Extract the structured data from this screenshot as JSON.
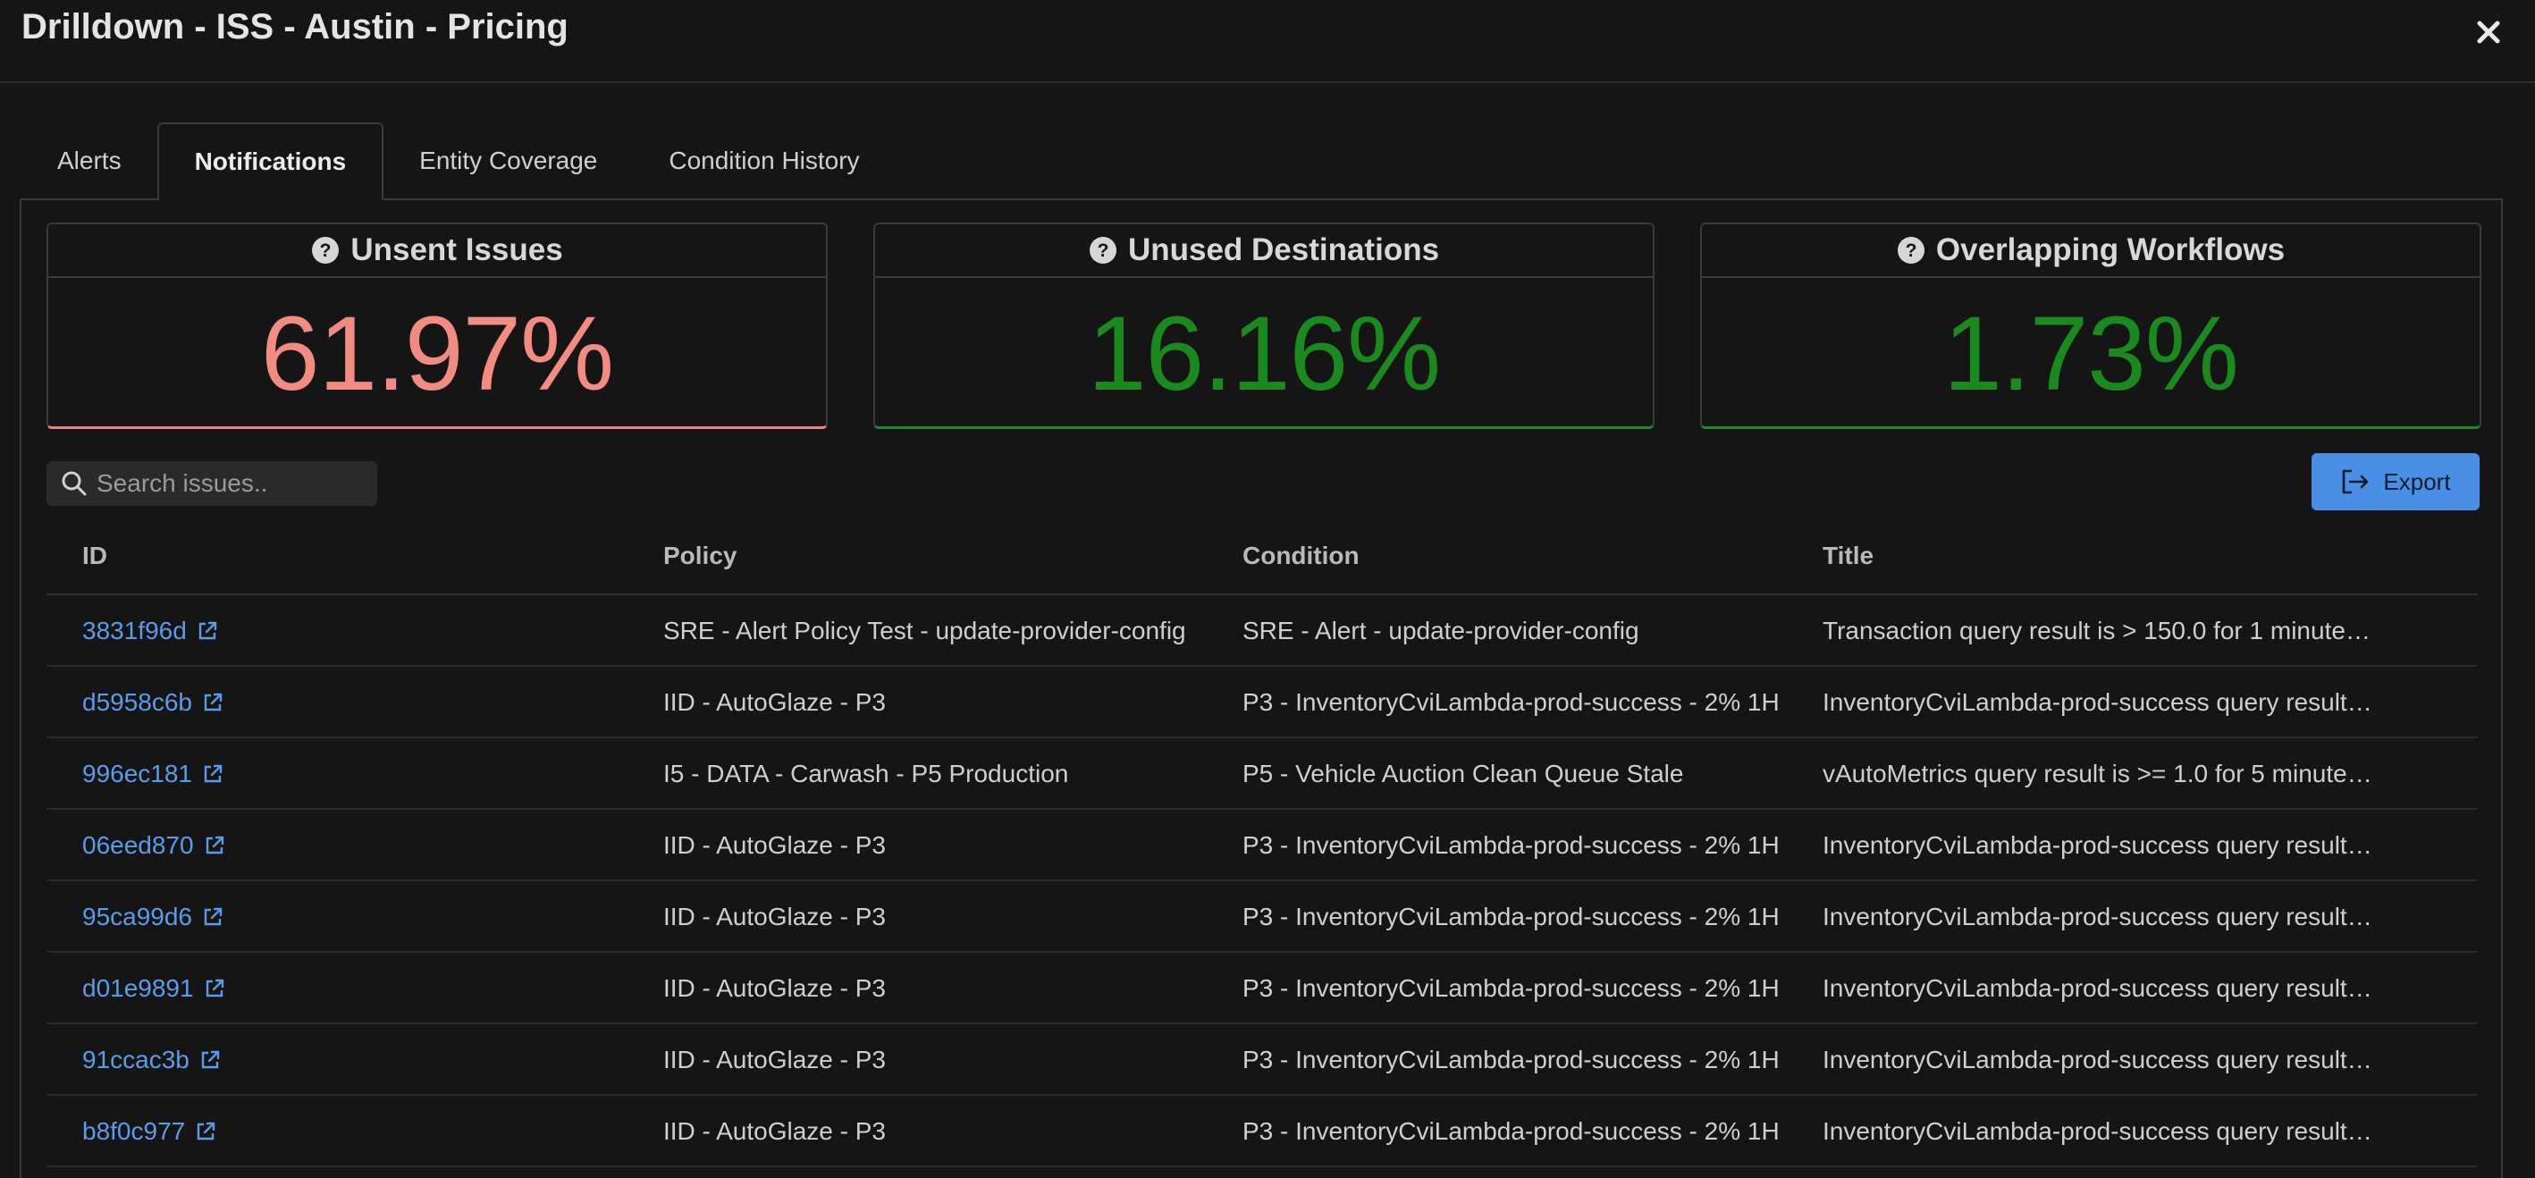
{
  "modal": {
    "title": "Drilldown - ISS - Austin - Pricing"
  },
  "tabs": [
    {
      "label": "Alerts",
      "active": false
    },
    {
      "label": "Notifications",
      "active": true
    },
    {
      "label": "Entity Coverage",
      "active": false
    },
    {
      "label": "Condition History",
      "active": false
    }
  ],
  "metrics": [
    {
      "title": "Unsent Issues",
      "value": "61.97%",
      "status_color": "#f28b82"
    },
    {
      "title": "Unused Destinations",
      "value": "16.16%",
      "status_color": "#1a8a1f"
    },
    {
      "title": "Overlapping Workflows",
      "value": "1.73%",
      "status_color": "#1a8a1f"
    }
  ],
  "search": {
    "placeholder": "Search issues..",
    "value": ""
  },
  "export": {
    "label": "Export",
    "color": "#4a8fe6"
  },
  "table": {
    "headers": {
      "id": "ID",
      "policy": "Policy",
      "condition": "Condition",
      "title": "Title"
    },
    "rows": [
      {
        "id": "3831f96d",
        "policy": "SRE - Alert Policy Test - update-provider-config",
        "condition": "SRE - Alert - update-provider-config",
        "title": "Transaction query result is > 150.0 for 1 minutes ..."
      },
      {
        "id": "d5958c6b",
        "policy": "IID - AutoGlaze - P3",
        "condition": "P3 - InventoryCviLambda-prod-success - 2% 1H",
        "title": "InventoryCviLambda-prod-success query result i..."
      },
      {
        "id": "996ec181",
        "policy": "I5 - DATA - Carwash - P5 Production",
        "condition": "P5 - Vehicle Auction Clean Queue Stale",
        "title": "vAutoMetrics query result is >= 1.0 for 5 minutes..."
      },
      {
        "id": "06eed870",
        "policy": "IID - AutoGlaze - P3",
        "condition": "P3 - InventoryCviLambda-prod-success - 2% 1H",
        "title": "InventoryCviLambda-prod-success query result i..."
      },
      {
        "id": "95ca99d6",
        "policy": "IID - AutoGlaze - P3",
        "condition": "P3 - InventoryCviLambda-prod-success - 2% 1H",
        "title": "InventoryCviLambda-prod-success query result i..."
      },
      {
        "id": "d01e9891",
        "policy": "IID - AutoGlaze - P3",
        "condition": "P3 - InventoryCviLambda-prod-success - 2% 1H",
        "title": "InventoryCviLambda-prod-success query result i..."
      },
      {
        "id": "91ccac3b",
        "policy": "IID - AutoGlaze - P3",
        "condition": "P3 - InventoryCviLambda-prod-success - 2% 1H",
        "title": "InventoryCviLambda-prod-success query result i..."
      },
      {
        "id": "b8f0c977",
        "policy": "IID - AutoGlaze - P3",
        "condition": "P3 - InventoryCviLambda-prod-success - 2% 1H",
        "title": "InventoryCviLambda-prod-success query result i..."
      }
    ]
  },
  "icons": {
    "close": "close-icon",
    "help": "help-icon",
    "search": "search-icon",
    "export": "export-icon",
    "external_link": "external-link-icon"
  }
}
